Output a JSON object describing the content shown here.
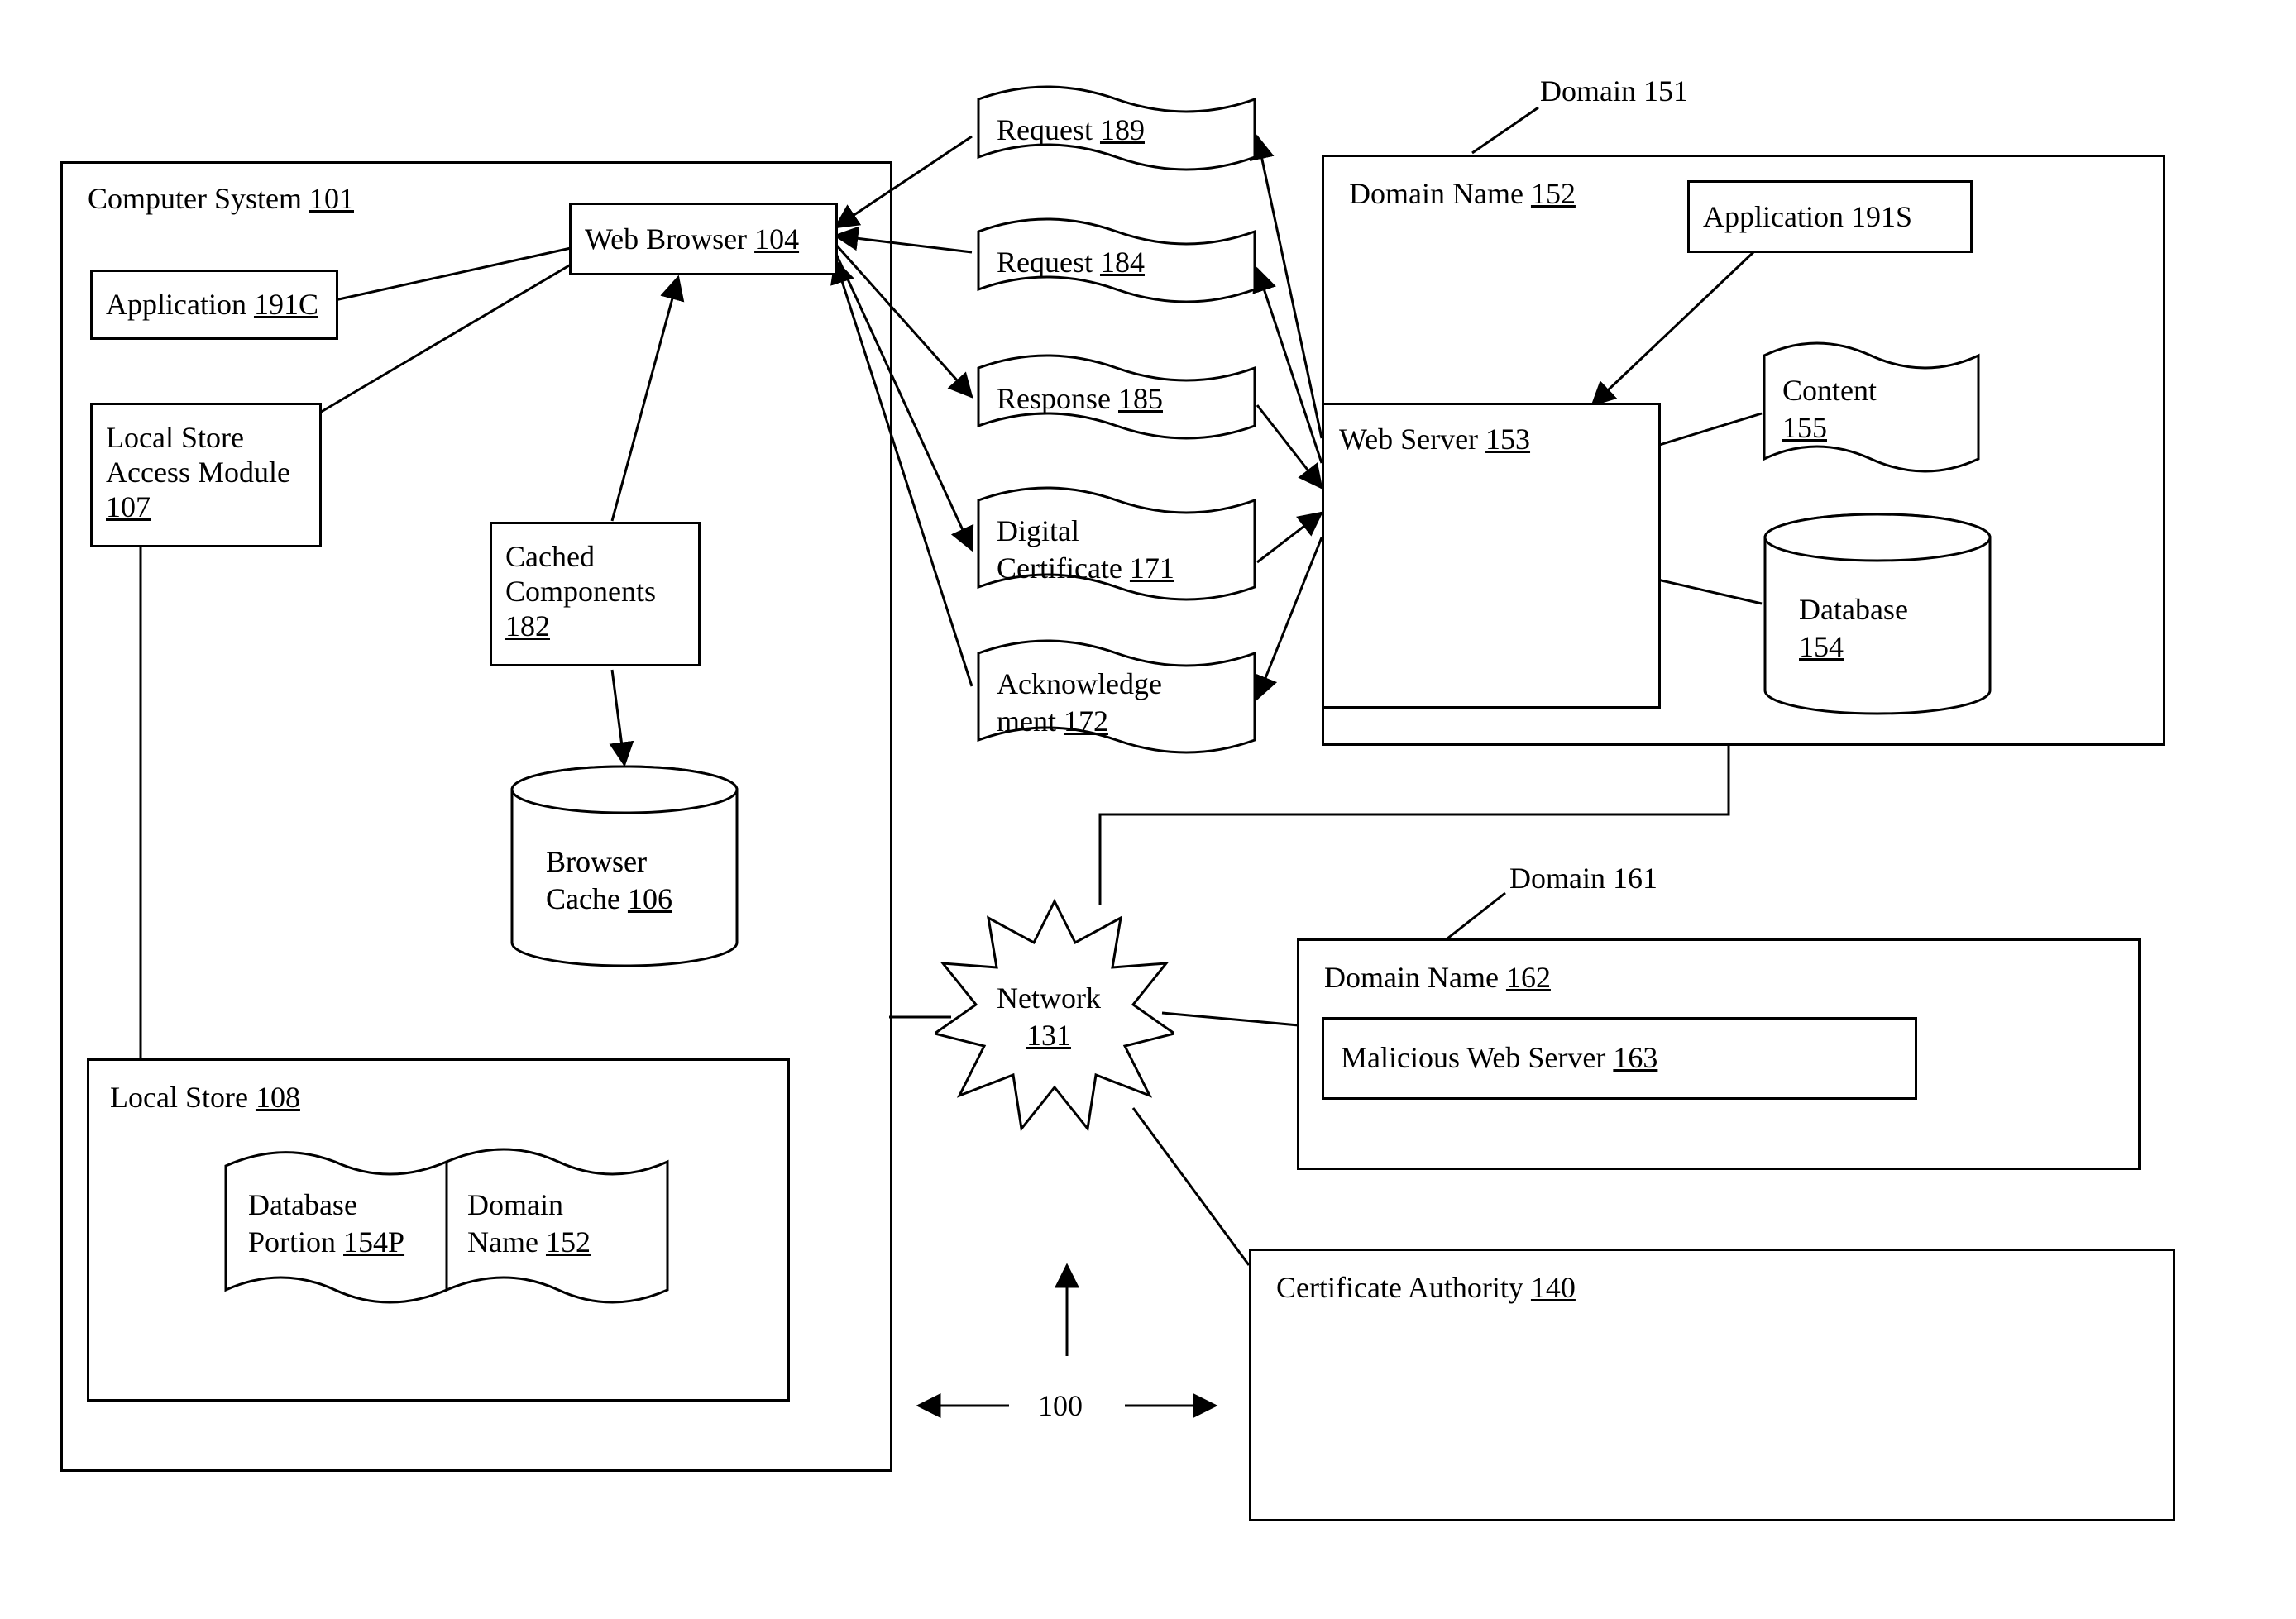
{
  "figureRef": "100",
  "computerSystem": {
    "label": "Computer System",
    "num": "101",
    "applicationClient": {
      "label": "Application",
      "num": "191C"
    },
    "webBrowser": {
      "label": "Web Browser",
      "num": "104"
    },
    "localStoreAccess": {
      "label": "Local Store\nAccess Module",
      "num": "107"
    },
    "cachedComponents": {
      "label": "Cached\nComponents",
      "num": "182"
    },
    "browserCache": {
      "label": "Browser\nCache",
      "num": "106"
    },
    "localStore": {
      "label": "Local Store",
      "num": "108",
      "databasePortion": {
        "label": "Database\nPortion",
        "num": "154P"
      },
      "domainName": {
        "label": "Domain\nName",
        "num": "152"
      }
    }
  },
  "messages": {
    "request189": {
      "label": "Request",
      "num": "189"
    },
    "request184": {
      "label": "Request",
      "num": "184"
    },
    "response185": {
      "label": "Response",
      "num": "185"
    },
    "digitalCert": {
      "label": "Digital\nCertificate",
      "num": "171"
    },
    "ack": {
      "label": "Acknowledge\nment",
      "num": "172"
    }
  },
  "network": {
    "label": "Network",
    "num": "131"
  },
  "domain151": {
    "label": "Domain 151",
    "domainName": {
      "label": "Domain Name",
      "num": "152"
    },
    "applicationServer": {
      "label": "Application 191S"
    },
    "webServer": {
      "label": "Web Server",
      "num": "153"
    },
    "content": {
      "label": "Content",
      "num": "155"
    },
    "database": {
      "label": "Database",
      "num": "154"
    }
  },
  "domain161": {
    "label": "Domain 161",
    "domainName": {
      "label": "Domain Name",
      "num": "162"
    },
    "maliciousWebServer": {
      "label": "Malicious Web Server",
      "num": "163"
    }
  },
  "certAuthority": {
    "label": "Certificate Authority",
    "num": "140"
  }
}
